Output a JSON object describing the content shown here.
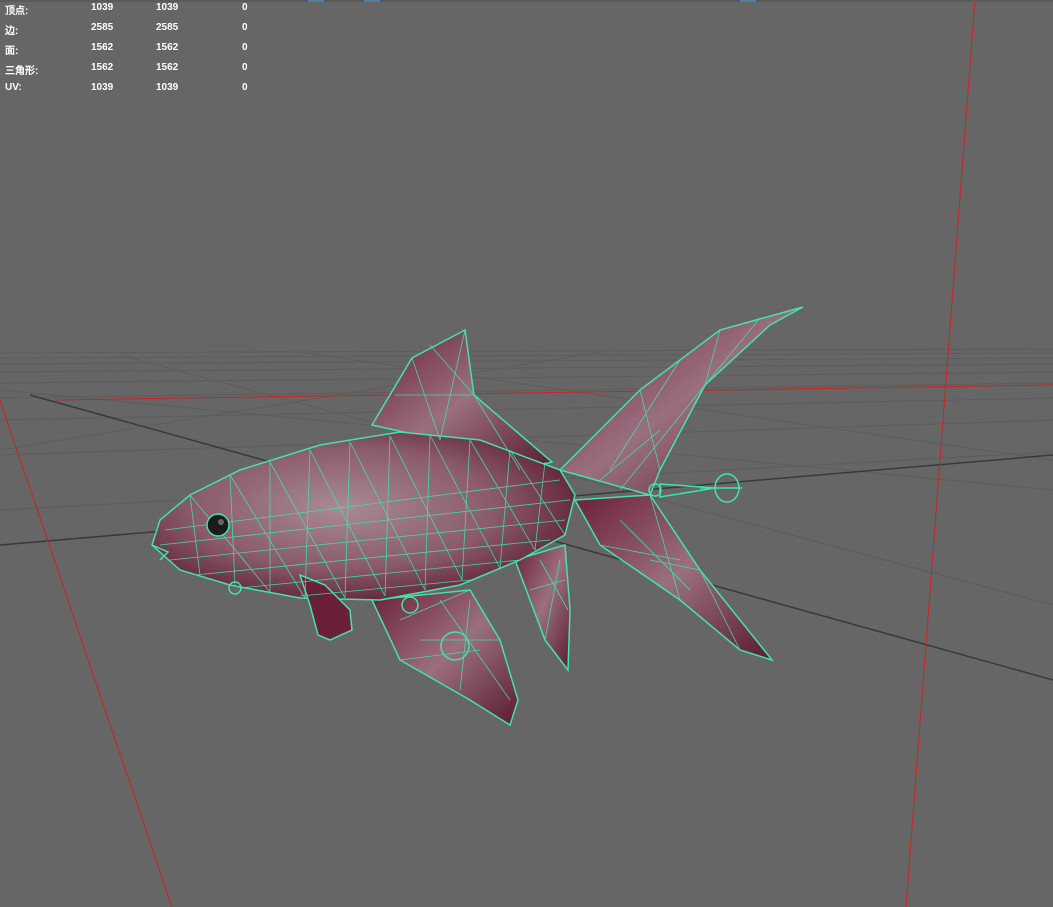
{
  "viewport": {
    "name": "perspective-viewport",
    "background": "#666666",
    "wireframe_color": "#3fe6a6",
    "fish_fill": "#7a2c45",
    "axis_color": "#cc2222"
  },
  "hud": {
    "rows": [
      {
        "label": "顶点:",
        "c1": "1039",
        "c2": "1039",
        "c3": "0"
      },
      {
        "label": "边:",
        "c1": "2585",
        "c2": "2585",
        "c3": "0"
      },
      {
        "label": "面:",
        "c1": "1562",
        "c2": "1562",
        "c3": "0"
      },
      {
        "label": "三角形:",
        "c1": "1562",
        "c2": "1562",
        "c3": "0"
      },
      {
        "label": "UV:",
        "c1": "1039",
        "c2": "1039",
        "c3": "0"
      }
    ]
  }
}
